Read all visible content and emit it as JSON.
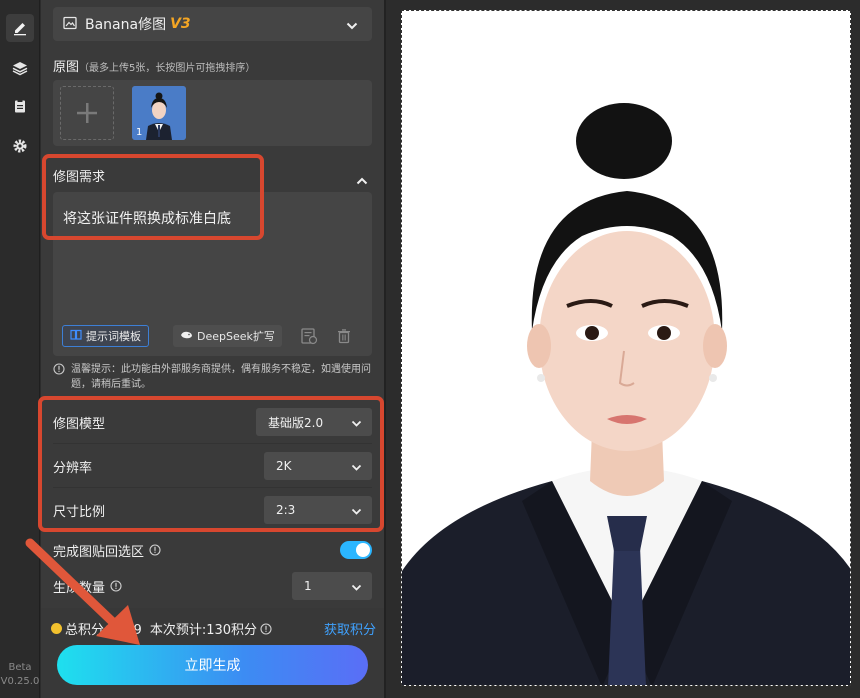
{
  "rail": {
    "version_line1": "Beta",
    "version_line2": "V0.25.0"
  },
  "tool_select": {
    "name": "Banana修图",
    "version": "V3"
  },
  "source_images": {
    "label": "原图",
    "hint": "（最多上传5张，长按图片可拖拽排序）",
    "thumb_index": "1"
  },
  "edit_request": {
    "label": "修图需求",
    "prompt": "将这张证件照换成标准白底",
    "template_chip": "提示词模板",
    "deepseek_chip": "DeepSeek扩写"
  },
  "notice": "温馨提示：此功能由外部服务商提供，偶有服务不稳定，如遇使用问题，请稍后重试。",
  "settings": {
    "model_label": "修图模型",
    "model_value": "基础版2.0",
    "resolution_label": "分辨率",
    "resolution_value": "2K",
    "ratio_label": "尺寸比例",
    "ratio_value": "2:3",
    "paste_back_label": "完成图贴回选区",
    "paste_back_on": true,
    "count_label": "生成数量",
    "count_value": "1"
  },
  "points": {
    "total": "总积分：739",
    "estimate": "本次预计:130积分",
    "get_points": "获取积分"
  },
  "generate_button": "立即生成",
  "colors": {
    "accent_orange": "#f5a623",
    "accent_blue": "#3fa2ff",
    "highlight_red": "#d7472f",
    "toggle_on": "#2bb6ff"
  }
}
